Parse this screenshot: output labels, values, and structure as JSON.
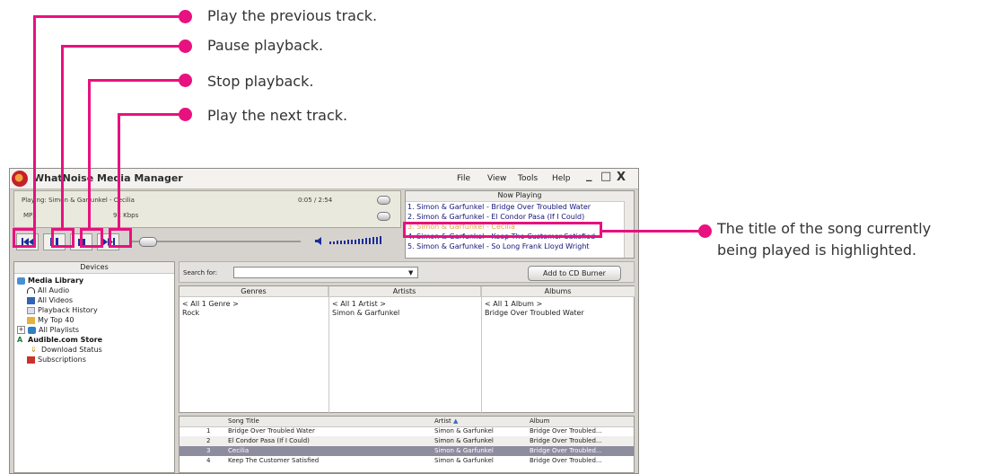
{
  "callouts": {
    "prev": "Play the previous track.",
    "pause": "Pause playback.",
    "stop": "Stop playback.",
    "next": "Play the next track.",
    "highlight": "The title of the song currently being played is highlighted."
  },
  "colors": {
    "accent": "#e8117f",
    "current_track": "#e6a43c"
  },
  "app": {
    "title": "WhatNoise Media Manager",
    "menu": [
      "File",
      "View",
      "Tools",
      "Help"
    ],
    "window_controls": [
      "_",
      "□",
      "X"
    ]
  },
  "player": {
    "playing": "Playing: Simon & Garfunkel - Cecilia",
    "time": "0:05 / 2:54",
    "format": "MP3",
    "bitrate": "92 Kbps",
    "icons": [
      "previous-icon",
      "pause-icon",
      "stop-icon",
      "next-icon",
      "volume-icon"
    ]
  },
  "now_playing": {
    "title": "Now Playing",
    "items": [
      "1. Simon & Garfunkel - Bridge Over Troubled Water",
      "2. Simon & Garfunkel - El Condor Pasa (If I Could)",
      "3. Simon & Garfunkel - Cecilia",
      "4. Simon & Garfunkel - Keep The Customer Satisfied",
      "5. Simon & Garfunkel - So Long Frank Lloyd Wright"
    ]
  },
  "devices": {
    "title": "Devices",
    "items": [
      {
        "label": "Media Library",
        "bold": true
      },
      {
        "label": "All Audio"
      },
      {
        "label": "All Videos"
      },
      {
        "label": "Playback History"
      },
      {
        "label": "My Top 40"
      },
      {
        "label": "All Playlists"
      },
      {
        "label": "Audible.com Store",
        "bold": true
      },
      {
        "label": "Download Status"
      },
      {
        "label": "Subscriptions"
      }
    ]
  },
  "search": {
    "label": "Search for:",
    "value": "",
    "cd_button": "Add to CD Burner"
  },
  "columns": {
    "genres": {
      "header": "Genres",
      "all": "< All 1 Genre >",
      "item": "Rock"
    },
    "artists": {
      "header": "Artists",
      "all": "< All 1 Artist >",
      "item": "Simon & Garfunkel"
    },
    "albums": {
      "header": "Albums",
      "all": "< All 1 Album >",
      "item": "Bridge Over Troubled Water"
    }
  },
  "tracks": {
    "headers": {
      "song": "Song Title",
      "artist": "Artist",
      "album": "Album"
    },
    "rows": [
      {
        "num": "1",
        "title": "Bridge Over Troubled Water",
        "artist": "Simon & Garfunkel",
        "album": "Bridge Over Troubled..."
      },
      {
        "num": "2",
        "title": "El Condor Pasa (If I Could)",
        "artist": "Simon & Garfunkel",
        "album": "Bridge Over Troubled..."
      },
      {
        "num": "3",
        "title": "Cecilia",
        "artist": "Simon & Garfunkel",
        "album": "Bridge Over Troubled..."
      },
      {
        "num": "4",
        "title": "Keep The Customer Satisfied",
        "artist": "Simon & Garfunkel",
        "album": "Bridge Over Troubled..."
      }
    ]
  }
}
